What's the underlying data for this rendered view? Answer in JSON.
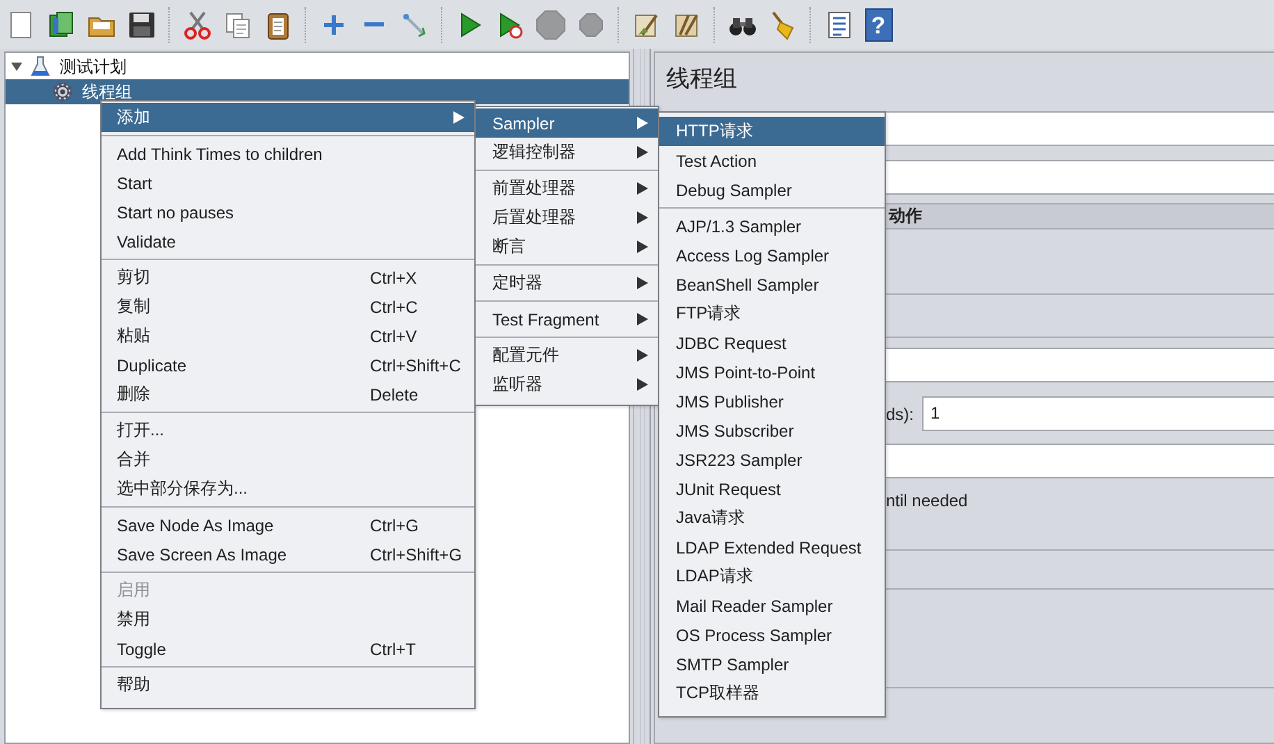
{
  "toolbar": [
    {
      "kind": "new",
      "disabled": false
    },
    {
      "kind": "templates",
      "disabled": false
    },
    {
      "kind": "open",
      "disabled": false
    },
    {
      "kind": "save",
      "disabled": false
    },
    {
      "kind": "separator"
    },
    {
      "kind": "cut",
      "disabled": false
    },
    {
      "kind": "copy",
      "disabled": false
    },
    {
      "kind": "paste",
      "disabled": false
    },
    {
      "kind": "separator"
    },
    {
      "kind": "expand",
      "disabled": false
    },
    {
      "kind": "collapse",
      "disabled": false
    },
    {
      "kind": "toggle",
      "disabled": false
    },
    {
      "kind": "separator"
    },
    {
      "kind": "start",
      "disabled": false
    },
    {
      "kind": "start-no-pauses",
      "disabled": false
    },
    {
      "kind": "stop",
      "disabled": true
    },
    {
      "kind": "shutdown",
      "disabled": true
    },
    {
      "kind": "separator"
    },
    {
      "kind": "clear",
      "disabled": false
    },
    {
      "kind": "clear-all",
      "disabled": false
    },
    {
      "kind": "separator"
    },
    {
      "kind": "search",
      "disabled": false
    },
    {
      "kind": "reset-search",
      "disabled": false
    },
    {
      "kind": "separator"
    },
    {
      "kind": "functions",
      "disabled": false
    },
    {
      "kind": "help",
      "disabled": false,
      "glyph": "?"
    }
  ],
  "tree": {
    "items": [
      {
        "label": "测试计划",
        "kind": "test-plan",
        "expanded": true,
        "selected": false,
        "children": [
          {
            "label": "线程组",
            "kind": "thread-group",
            "selected": true
          }
        ]
      }
    ]
  },
  "panel": {
    "title": "线程组",
    "section_heading": "动作",
    "field_label": "ds):",
    "field_value": "1",
    "option_label": "ntil needed"
  },
  "menus": [
    {
      "items": [
        {
          "kind": "item",
          "label": "添加",
          "selected": true,
          "disabled": false,
          "submenu": true
        },
        {
          "kind": "separator"
        },
        {
          "kind": "item",
          "label": "Add Think Times to children",
          "selected": false,
          "disabled": false,
          "submenu": false
        },
        {
          "kind": "item",
          "label": "Start",
          "selected": false,
          "disabled": false,
          "submenu": false
        },
        {
          "kind": "item",
          "label": "Start no pauses",
          "selected": false,
          "disabled": false,
          "submenu": false
        },
        {
          "kind": "item",
          "label": "Validate",
          "selected": false,
          "disabled": false,
          "submenu": false
        },
        {
          "kind": "separator"
        },
        {
          "kind": "item",
          "label": "剪切",
          "shortcut": "Ctrl+X",
          "selected": false,
          "disabled": false,
          "submenu": false
        },
        {
          "kind": "item",
          "label": "复制",
          "shortcut": "Ctrl+C",
          "selected": false,
          "disabled": false,
          "submenu": false
        },
        {
          "kind": "item",
          "label": "粘贴",
          "shortcut": "Ctrl+V",
          "selected": false,
          "disabled": false,
          "submenu": false
        },
        {
          "kind": "item",
          "label": "Duplicate",
          "shortcut": "Ctrl+Shift+C",
          "selected": false,
          "disabled": false,
          "submenu": false
        },
        {
          "kind": "item",
          "label": "删除",
          "shortcut": "Delete",
          "selected": false,
          "disabled": false,
          "submenu": false
        },
        {
          "kind": "separator"
        },
        {
          "kind": "item",
          "label": "打开...",
          "selected": false,
          "disabled": false,
          "submenu": false
        },
        {
          "kind": "item",
          "label": "合并",
          "selected": false,
          "disabled": false,
          "submenu": false
        },
        {
          "kind": "item",
          "label": "选中部分保存为...",
          "selected": false,
          "disabled": false,
          "submenu": false
        },
        {
          "kind": "separator"
        },
        {
          "kind": "item",
          "label": "Save Node As Image",
          "shortcut": "Ctrl+G",
          "selected": false,
          "disabled": false,
          "submenu": false
        },
        {
          "kind": "item",
          "label": "Save Screen As Image",
          "shortcut": "Ctrl+Shift+G",
          "selected": false,
          "disabled": false,
          "submenu": false
        },
        {
          "kind": "separator"
        },
        {
          "kind": "item",
          "label": "启用",
          "selected": false,
          "disabled": true,
          "submenu": false
        },
        {
          "kind": "item",
          "label": "禁用",
          "selected": false,
          "disabled": false,
          "submenu": false
        },
        {
          "kind": "item",
          "label": "Toggle",
          "shortcut": "Ctrl+T",
          "selected": false,
          "disabled": false,
          "submenu": false
        },
        {
          "kind": "separator"
        },
        {
          "kind": "item",
          "label": "帮助",
          "selected": false,
          "disabled": false,
          "submenu": false
        }
      ]
    },
    {
      "items": [
        {
          "kind": "item",
          "label": "Sampler",
          "selected": true,
          "disabled": false,
          "submenu": true
        },
        {
          "kind": "item",
          "label": "逻辑控制器",
          "selected": false,
          "disabled": false,
          "submenu": true
        },
        {
          "kind": "separator"
        },
        {
          "kind": "item",
          "label": "前置处理器",
          "selected": false,
          "disabled": false,
          "submenu": true
        },
        {
          "kind": "item",
          "label": "后置处理器",
          "selected": false,
          "disabled": false,
          "submenu": true
        },
        {
          "kind": "item",
          "label": "断言",
          "selected": false,
          "disabled": false,
          "submenu": true
        },
        {
          "kind": "separator"
        },
        {
          "kind": "item",
          "label": "定时器",
          "selected": false,
          "disabled": false,
          "submenu": true
        },
        {
          "kind": "separator"
        },
        {
          "kind": "item",
          "label": "Test Fragment",
          "selected": false,
          "disabled": false,
          "submenu": true
        },
        {
          "kind": "separator"
        },
        {
          "kind": "item",
          "label": "配置元件",
          "selected": false,
          "disabled": false,
          "submenu": true
        },
        {
          "kind": "item",
          "label": "监听器",
          "selected": false,
          "disabled": false,
          "submenu": true
        }
      ]
    },
    {
      "items": [
        {
          "kind": "item",
          "label": "HTTP请求",
          "selected": true,
          "disabled": false,
          "submenu": false
        },
        {
          "kind": "item",
          "label": "Test Action",
          "selected": false,
          "disabled": false,
          "submenu": false
        },
        {
          "kind": "item",
          "label": "Debug Sampler",
          "selected": false,
          "disabled": false,
          "submenu": false
        },
        {
          "kind": "separator"
        },
        {
          "kind": "item",
          "label": "AJP/1.3 Sampler",
          "selected": false,
          "disabled": false,
          "submenu": false
        },
        {
          "kind": "item",
          "label": "Access Log Sampler",
          "selected": false,
          "disabled": false,
          "submenu": false
        },
        {
          "kind": "item",
          "label": "BeanShell Sampler",
          "selected": false,
          "disabled": false,
          "submenu": false
        },
        {
          "kind": "item",
          "label": "FTP请求",
          "selected": false,
          "disabled": false,
          "submenu": false
        },
        {
          "kind": "item",
          "label": "JDBC Request",
          "selected": false,
          "disabled": false,
          "submenu": false
        },
        {
          "kind": "item",
          "label": "JMS Point-to-Point",
          "selected": false,
          "disabled": false,
          "submenu": false
        },
        {
          "kind": "item",
          "label": "JMS Publisher",
          "selected": false,
          "disabled": false,
          "submenu": false
        },
        {
          "kind": "item",
          "label": "JMS Subscriber",
          "selected": false,
          "disabled": false,
          "submenu": false
        },
        {
          "kind": "item",
          "label": "JSR223 Sampler",
          "selected": false,
          "disabled": false,
          "submenu": false
        },
        {
          "kind": "item",
          "label": "JUnit Request",
          "selected": false,
          "disabled": false,
          "submenu": false
        },
        {
          "kind": "item",
          "label": "Java请求",
          "selected": false,
          "disabled": false,
          "submenu": false
        },
        {
          "kind": "item",
          "label": "LDAP Extended Request",
          "selected": false,
          "disabled": false,
          "submenu": false
        },
        {
          "kind": "item",
          "label": "LDAP请求",
          "selected": false,
          "disabled": false,
          "submenu": false
        },
        {
          "kind": "item",
          "label": "Mail Reader Sampler",
          "selected": false,
          "disabled": false,
          "submenu": false
        },
        {
          "kind": "item",
          "label": "OS Process Sampler",
          "selected": false,
          "disabled": false,
          "submenu": false
        },
        {
          "kind": "item",
          "label": "SMTP Sampler",
          "selected": false,
          "disabled": false,
          "submenu": false
        },
        {
          "kind": "item",
          "label": "TCP取样器",
          "selected": false,
          "disabled": false,
          "submenu": false
        }
      ]
    }
  ]
}
